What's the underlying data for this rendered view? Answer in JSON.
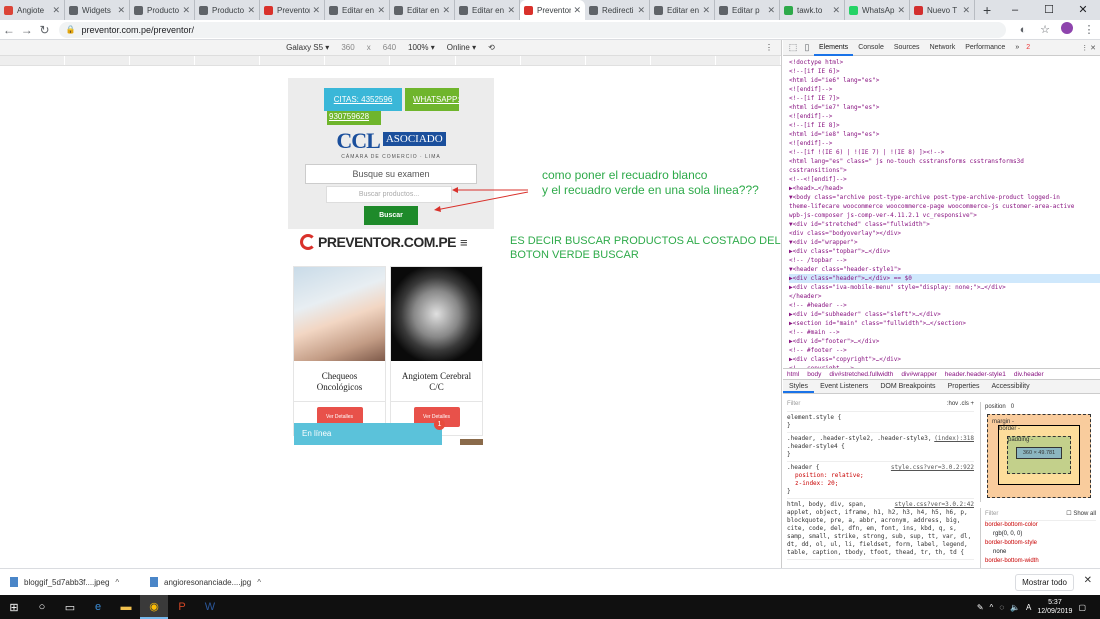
{
  "browser": {
    "tabs": [
      {
        "label": "Angiote",
        "color": "#db4437"
      },
      {
        "label": "Widgets",
        "color": "#5f6368"
      },
      {
        "label": "Producto",
        "color": "#5f6368"
      },
      {
        "label": "Producto",
        "color": "#5f6368"
      },
      {
        "label": "Preventor",
        "color": "#d9312b"
      },
      {
        "label": "Editar en",
        "color": "#5f6368"
      },
      {
        "label": "Editar en",
        "color": "#5f6368"
      },
      {
        "label": "Editar en",
        "color": "#5f6368"
      },
      {
        "label": "Preventor",
        "color": "#d9312b",
        "active": true
      },
      {
        "label": "Redirecti",
        "color": "#5f6368"
      },
      {
        "label": "Editar en",
        "color": "#5f6368"
      },
      {
        "label": "Editar p",
        "color": "#5f6368"
      },
      {
        "label": "tawk.to",
        "color": "#2eaa4a"
      },
      {
        "label": "WhatsAp",
        "color": "#25d366"
      },
      {
        "label": "Nuevo T",
        "color": "#d32f2f"
      }
    ],
    "url": "preventor.com.pe/preventor/"
  },
  "device_toolbar": {
    "device": "Galaxy S5 ▾",
    "width": "360",
    "x": "x",
    "height": "640",
    "zoom": "100% ▾",
    "network": "Online ▾"
  },
  "site": {
    "citas_label": "CITAS: 4352596",
    "whatsapp_label": "WHATSAPP:",
    "whatsapp_number": "930759628",
    "ccl_logo": "CCL",
    "ccl_asociado": "ASOCIADO",
    "ccl_sub": "CÁMARA DE COMERCIO · LIMA",
    "exam_placeholder": "Busque su examen",
    "product_placeholder": "Buscar productos...",
    "buscar_label": "Buscar",
    "brand": "PREVENTOR.COM.PE",
    "cards": [
      {
        "title": "Chequeos Oncológicos",
        "button": "Ver Detalles"
      },
      {
        "title": "Angiotem Cerebral C/C",
        "button": "Ver Detalles"
      }
    ],
    "chat_label": "En línea",
    "chat_badge": "1"
  },
  "annotations": {
    "note1_line1": "como poner el recuadro blanco",
    "note1_line2": "y el recuadro verde en una sola linea???",
    "note2": "ES DECIR BUSCAR PRODUCTOS AL COSTADO DEL BOTON VERDE BUSCAR"
  },
  "devtools": {
    "tabs": [
      "Elements",
      "Console",
      "Sources",
      "Network",
      "Performance"
    ],
    "error_count": "2",
    "dom_lines": [
      "<!doctype html>",
      "<!--[if IE 6]>",
      "<html id=\"ie6\" lang=\"es\">",
      "<![endif]-->",
      "<!--[if IE 7]>",
      "<html id=\"ie7\" lang=\"es\">",
      "<![endif]-->",
      "<!--[if IE 8]>",
      "<html id=\"ie8\" lang=\"es\">",
      "<![endif]-->",
      "<!--[if !(IE 6) | !(IE 7) | !(IE 8)  ]><!-->",
      "<html lang=\"es\" class=\" js no-touch csstransforms csstransforms3d",
      "csstransitions\">",
      "  <!--<![endif]-->",
      " ▶<head>…</head>",
      " ▼<body class=\"archive post-type-archive post-type-archive-product logged-in",
      " theme-lifecare woocommerce woocommerce-page woocommerce-js customer-area-active",
      " wpb-js-composer js-comp-ver-4.11.2.1 vc_responsive\">",
      "   ▼<div id=\"stretched\" class=\"fullwidth\">",
      "      <div class=\"bodyoverlay\"></div>",
      "     ▼<div id=\"wrapper\">",
      "       ▶<div class=\"topbar\">…</div>",
      "        <!-- /topbar -->",
      "       ▼<header class=\"header-style1\">",
      "         ▶<div class=\"header\">…</div> == $0",
      "         ▶<div class=\"iva-mobile-menu\" style=\"display: none;\">…</div>",
      "        </header>",
      "        <!-- #header -->",
      "       ▶<div id=\"subheader\" class=\"sleft\">…</div>",
      "       ▶<section id=\"main\" class=\"fullwidth\">…</section>",
      "        <!-- #main -->",
      "       ▶<div id=\"footer\">…</div>",
      "        <!-- #footer -->",
      "       ▶<div class=\"copyright\">…</div>",
      "        <!-- copyright -->"
    ],
    "selected_line": 24,
    "breadcrumbs": [
      "html",
      "body",
      "div#stretched.fullwidth",
      "div#wrapper",
      "header.header-style1",
      "div.header"
    ],
    "style_tabs": [
      "Styles",
      "Event Listeners",
      "DOM Breakpoints",
      "Properties",
      "Accessibility"
    ],
    "filter_placeholder": "Filter",
    "hov_cls": ":hov  .cls  +",
    "rules": [
      {
        "selector": "element.style {",
        "src": "",
        "props": [],
        "close": "}"
      },
      {
        "selector": ".header, .header-style2, .header-style3, .header-style4 {",
        "src": "(index):318",
        "props": [],
        "close": "}"
      },
      {
        "selector": ".header {",
        "src": "style.css?ver=3.0.2:922",
        "props": [
          "position: relative;",
          "z-index: 20;"
        ],
        "close": "}"
      },
      {
        "selector": "html, body, div, span, applet, object, iframe, h1, h2, h3, h4, h5, h6, p, blockquote, pre, a, abbr, acronym, address, big, cite, code, del, dfn, em, font, ins, kbd, q, s, samp, small, strike, strong, sub, sup, tt, var, dl, dt, dd, ol, ul, li, fieldset, form, label, legend, table, caption, tbody, tfoot, thead, tr, th, td {",
        "src": "style.css?ver=3.0.2:42",
        "props": [],
        "close": ""
      }
    ],
    "box": {
      "position_label": "position",
      "position_value": "0",
      "margin_label": "margin",
      "border_label": "border",
      "padding_label": "padding -",
      "content_size": "360 × 49.781",
      "dash": "-"
    },
    "computed_filter": "Filter",
    "show_all": "Show all",
    "computed": [
      {
        "prop": "border-bottom-color",
        "value": "rgb(0, 0, 0)"
      },
      {
        "prop": "border-bottom-style",
        "value": "none"
      },
      {
        "prop": "border-bottom-width",
        "value": ""
      }
    ]
  },
  "downloads": {
    "items": [
      "bloggif_5d7abb3f....jpeg",
      "angioresonanciade....jpg"
    ],
    "show_all_label": "Mostrar todo"
  },
  "taskbar": {
    "time": "5:37",
    "date": "12/09/2019"
  }
}
